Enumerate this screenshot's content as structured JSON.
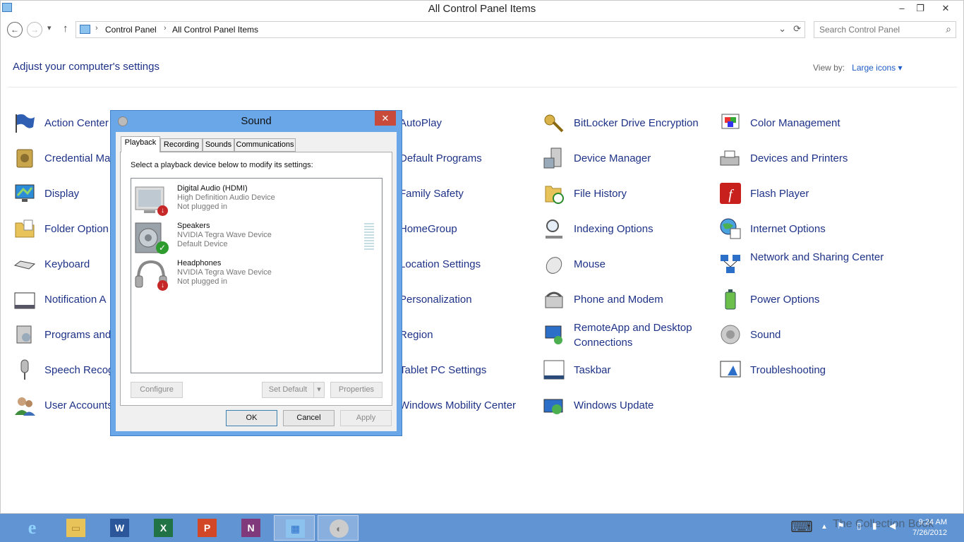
{
  "window": {
    "title": "All Control Panel Items",
    "minimize": "–",
    "maximize": "❐",
    "close": "✕"
  },
  "nav": {
    "back": "←",
    "forward": "→",
    "recent": "▾",
    "up": "↑"
  },
  "address": {
    "crumbs": [
      "Control Panel",
      "All Control Panel Items"
    ],
    "separator": "›",
    "dropdown": "⌄",
    "refresh": "⟳"
  },
  "search": {
    "placeholder": "Search Control Panel",
    "icon": "⌕"
  },
  "heading": "Adjust your computer's settings",
  "view_by": {
    "label": "View by:",
    "value": "Large icons ▾"
  },
  "items": [
    "Action Center",
    "Credential Ma",
    "Display",
    "Folder Option",
    "Keyboard",
    "Notification A",
    "Programs and",
    "Speech Recog",
    "User Accounts",
    "AutoPlay",
    "Default Programs",
    "Family Safety",
    "HomeGroup",
    "Location Settings",
    "Personalization",
    "Region",
    "Tablet PC Settings",
    "Windows Mobility Center",
    "BitLocker Drive Encryption",
    "Device Manager",
    "File History",
    "Indexing Options",
    "Mouse",
    "Phone and Modem",
    "RemoteApp and Desktop Connections",
    "Taskbar",
    "Windows Update",
    "Color Management",
    "Devices and Printers",
    "Flash Player",
    "Internet Options",
    "Network and Sharing Center",
    "Power Options",
    "Sound",
    "Troubleshooting"
  ],
  "dialog": {
    "title": "Sound",
    "close": "✕",
    "tabs": [
      "Playback",
      "Recording",
      "Sounds",
      "Communications"
    ],
    "instruction": "Select a playback device below to modify its settings:",
    "devices": [
      {
        "name": "Digital Audio (HDMI)",
        "driver": "High Definition Audio Device",
        "status": "Not plugged in",
        "badge": "↓"
      },
      {
        "name": "Speakers",
        "driver": "NVIDIA Tegra Wave Device",
        "status": "Default Device",
        "badge": "✓"
      },
      {
        "name": "Headphones",
        "driver": "NVIDIA Tegra Wave Device",
        "status": "Not plugged in",
        "badge": "↓"
      }
    ],
    "buttons": {
      "configure": "Configure",
      "set_default": "Set Default",
      "set_default_arrow": "▾",
      "properties": "Properties",
      "ok": "OK",
      "cancel": "Cancel",
      "apply": "Apply"
    }
  },
  "taskbar": {
    "apps": [
      {
        "glyph": "e"
      },
      {
        "glyph": "▭"
      },
      {
        "glyph": "W"
      },
      {
        "glyph": "X"
      },
      {
        "glyph": "P"
      },
      {
        "glyph": "N"
      },
      {
        "glyph": "▦"
      },
      {
        "glyph": "◐"
      }
    ],
    "tray": {
      "keyboard": "⌨",
      "chevron": "▲",
      "flag": "⚑",
      "battery": "▯",
      "signal": "▮",
      "volume": "◀"
    },
    "time": "9:24 AM",
    "date": "7/26/2012",
    "watermark": "The Collection Book"
  },
  "colors": {
    "link": "#1e3287",
    "accent": "#6aa7e8",
    "taskbar": "#6094d2",
    "close": "#c74a3a"
  }
}
